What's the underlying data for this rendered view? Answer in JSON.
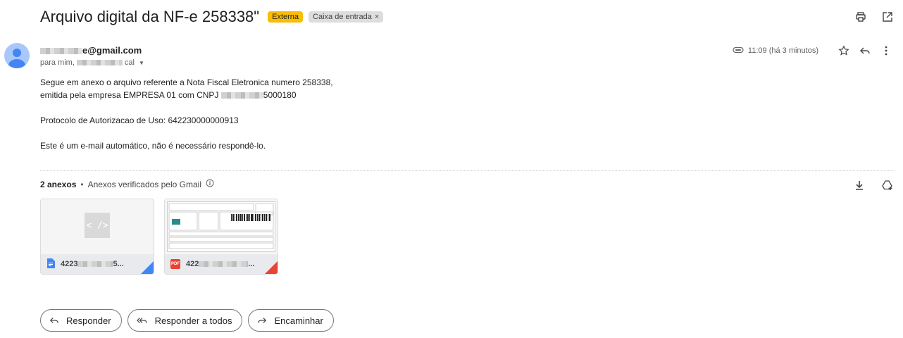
{
  "subject": "Arquivo digital da NF-e 258338\"",
  "labels": {
    "external": "Externa",
    "inbox": "Caixa de entrada",
    "inbox_remove": "×"
  },
  "sender": {
    "email_suffix": "e@gmail.com"
  },
  "recipient": {
    "prefix": "para mim,",
    "suffix": "cal"
  },
  "timestamp": "11:09 (há 3 minutos)",
  "body": {
    "line1": "Segue em anexo o arquivo referente a Nota Fiscal Eletronica numero 258338,",
    "line2_prefix": "emitida pela empresa EMPRESA 01 com CNPJ",
    "line2_suffix": "5000180",
    "protocol": "Protocolo de Autorizacao de Uso: 642230000000913",
    "auto": "Este é um e-mail automático, não é necessário respondê-lo."
  },
  "attachments": {
    "count_label": "2 anexos",
    "separator": "•",
    "verified": "Anexos verificados pelo Gmail",
    "items": [
      {
        "name_prefix": "4223",
        "name_suffix": "5...",
        "type": "xml",
        "accent": "#4285f4"
      },
      {
        "name_prefix": "422",
        "name_suffix": "...",
        "type": "pdf",
        "accent": "#ea4335",
        "badge": "PDF"
      }
    ]
  },
  "actions": {
    "reply": "Responder",
    "reply_all": "Responder a todos",
    "forward": "Encaminhar"
  },
  "colors": {
    "external_label": "#fbbc04",
    "avatar": "#a8c7fa"
  }
}
